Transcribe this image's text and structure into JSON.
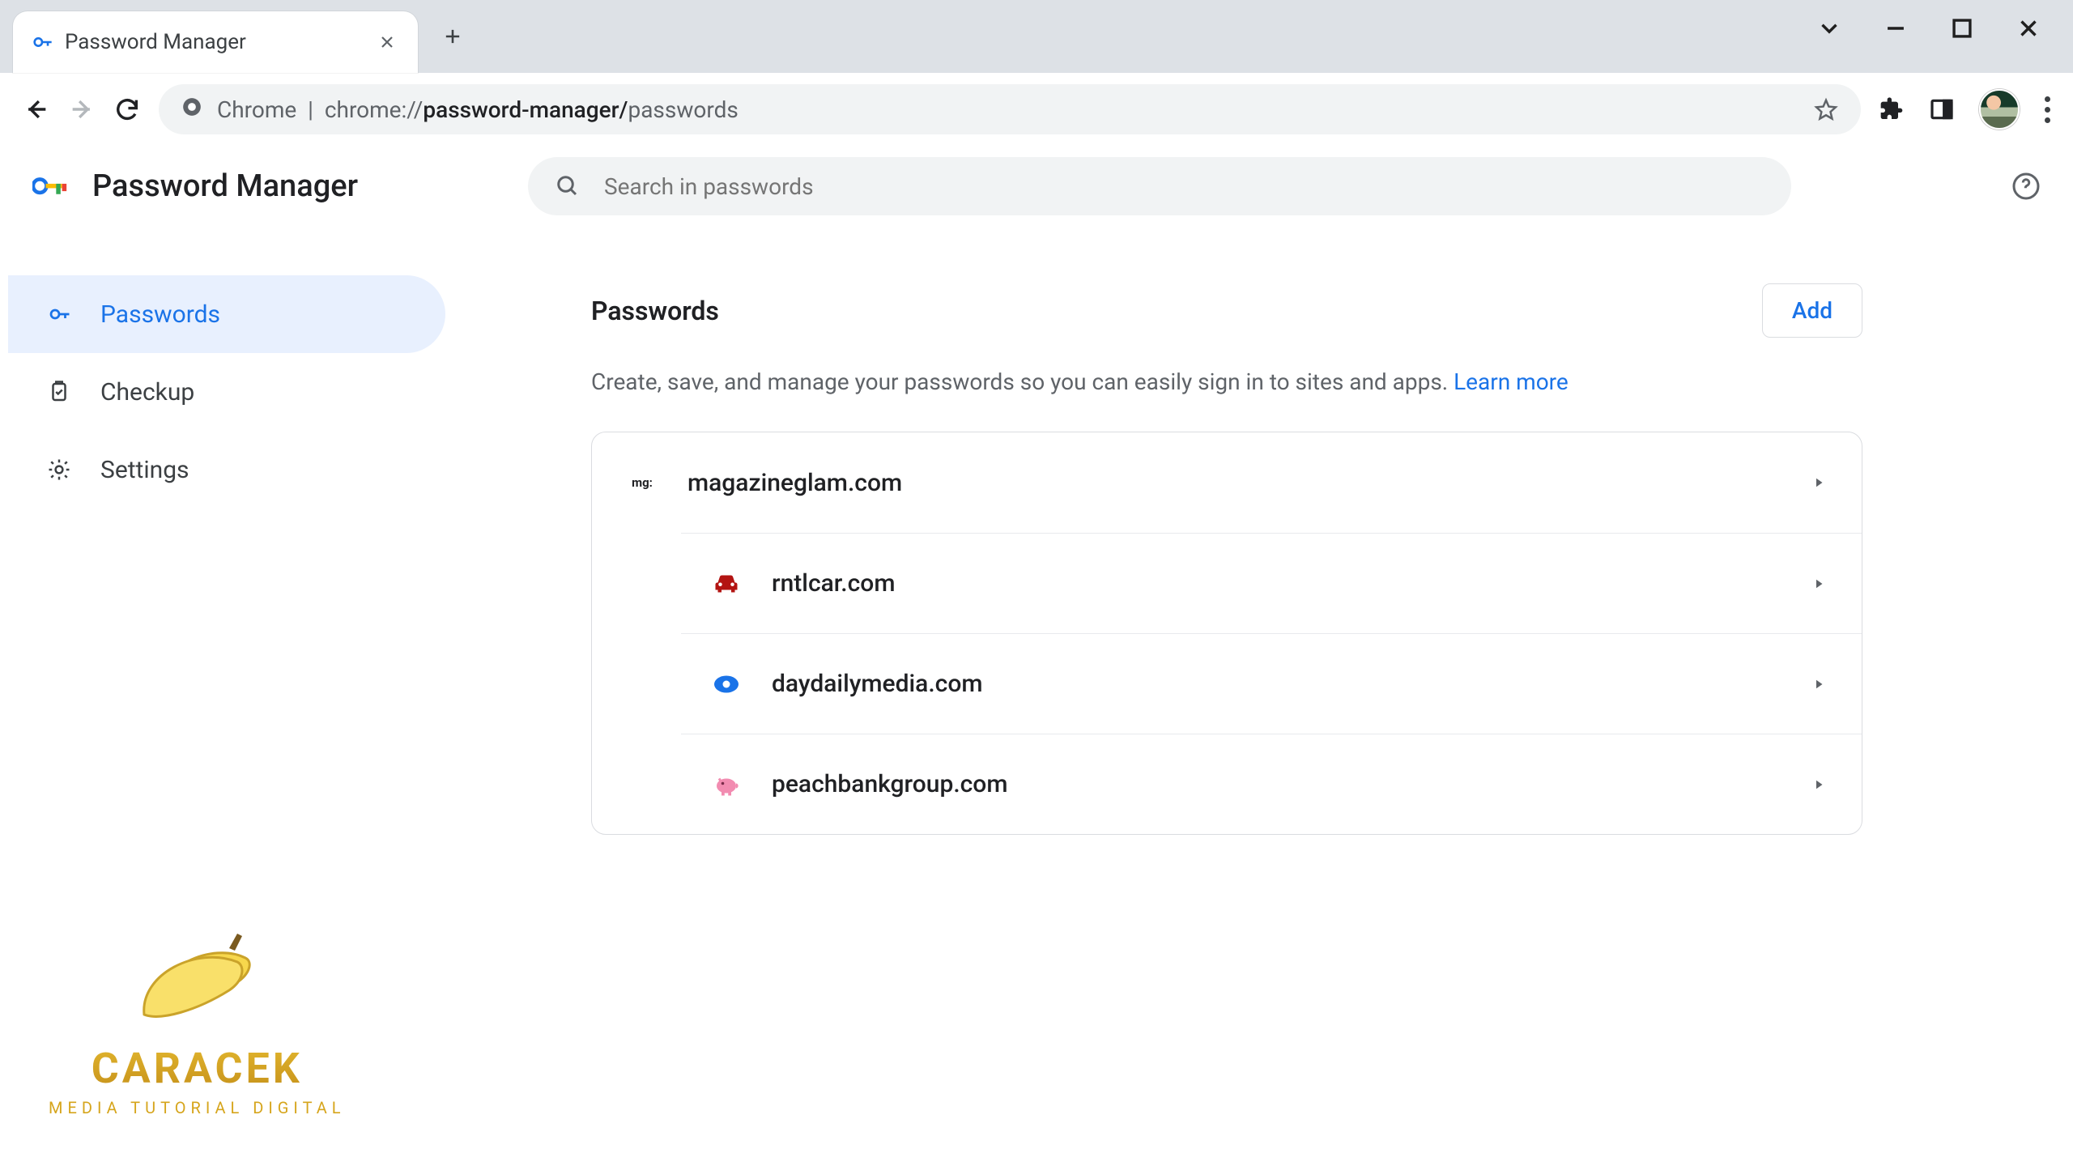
{
  "browser": {
    "tab_title": "Password Manager",
    "url_scheme": "Chrome",
    "url_path_prefix": "chrome://",
    "url_path_bold": "password-manager/",
    "url_path_tail": "passwords"
  },
  "header": {
    "app_title": "Password Manager",
    "search_placeholder": "Search in passwords"
  },
  "sidebar": {
    "items": [
      {
        "label": "Passwords"
      },
      {
        "label": "Checkup"
      },
      {
        "label": "Settings"
      }
    ]
  },
  "main": {
    "heading": "Passwords",
    "add_label": "Add",
    "description_text": "Create, save, and manage your passwords so you can easily sign in to sites and apps. ",
    "learn_more": "Learn more",
    "entries": [
      {
        "domain": "magazineglam.com",
        "icon_label": "mg:",
        "icon_bg": "#ffffff",
        "icon_fg": "#202124"
      },
      {
        "domain": "rntlcar.com",
        "icon_type": "car",
        "icon_color": "#b31412"
      },
      {
        "domain": "daydailymedia.com",
        "icon_type": "dot",
        "icon_color": "#1a73e8"
      },
      {
        "domain": "peachbankgroup.com",
        "icon_type": "pig",
        "icon_color": "#f28cb1"
      }
    ]
  },
  "watermark": {
    "brand": "CARACEK",
    "tagline": "MEDIA TUTORIAL DIGITAL"
  }
}
